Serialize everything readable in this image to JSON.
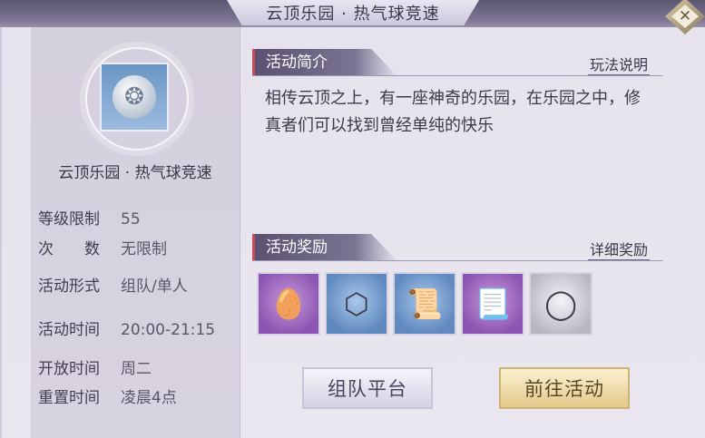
{
  "window": {
    "title": "云顶乐园 · 热气球竞速",
    "close_icon": "close-icon"
  },
  "left": {
    "emblem_icon": "dragon-medallion-icon",
    "activity_name": "云顶乐园 · 热气球竞速",
    "info": [
      {
        "label": "等级限制",
        "value": "55"
      },
      {
        "label": "次　　数",
        "value": "无限制"
      },
      {
        "label": "活动形式",
        "value": "组队/单人"
      },
      {
        "label": "活动时间",
        "value": "20:00-21:15"
      },
      {
        "label": "开放时间",
        "value": "周二"
      },
      {
        "label": "重置时间",
        "value": "凌晨4点"
      }
    ]
  },
  "intro": {
    "header": "活动简介",
    "link": "玩法说明",
    "text": "相传云顶之上，有一座神奇的乐园，在乐园之中，修真者们可以找到曾经单纯的快乐"
  },
  "rewards": {
    "header": "活动奖励",
    "link": "详细奖励",
    "items": [
      {
        "icon": "seed-stone-icon",
        "rarity": "purple"
      },
      {
        "icon": "necklace-icon",
        "rarity": "blue"
      },
      {
        "icon": "scroll-icon",
        "rarity": "blue"
      },
      {
        "icon": "paper-talisman-icon",
        "rarity": "purple"
      },
      {
        "icon": "mirror-icon",
        "rarity": "gray"
      }
    ]
  },
  "buttons": {
    "team": "组队平台",
    "go": "前往活动"
  },
  "colors": {
    "accent_red": "#c94a5a",
    "header_purple": "#5a5270"
  }
}
